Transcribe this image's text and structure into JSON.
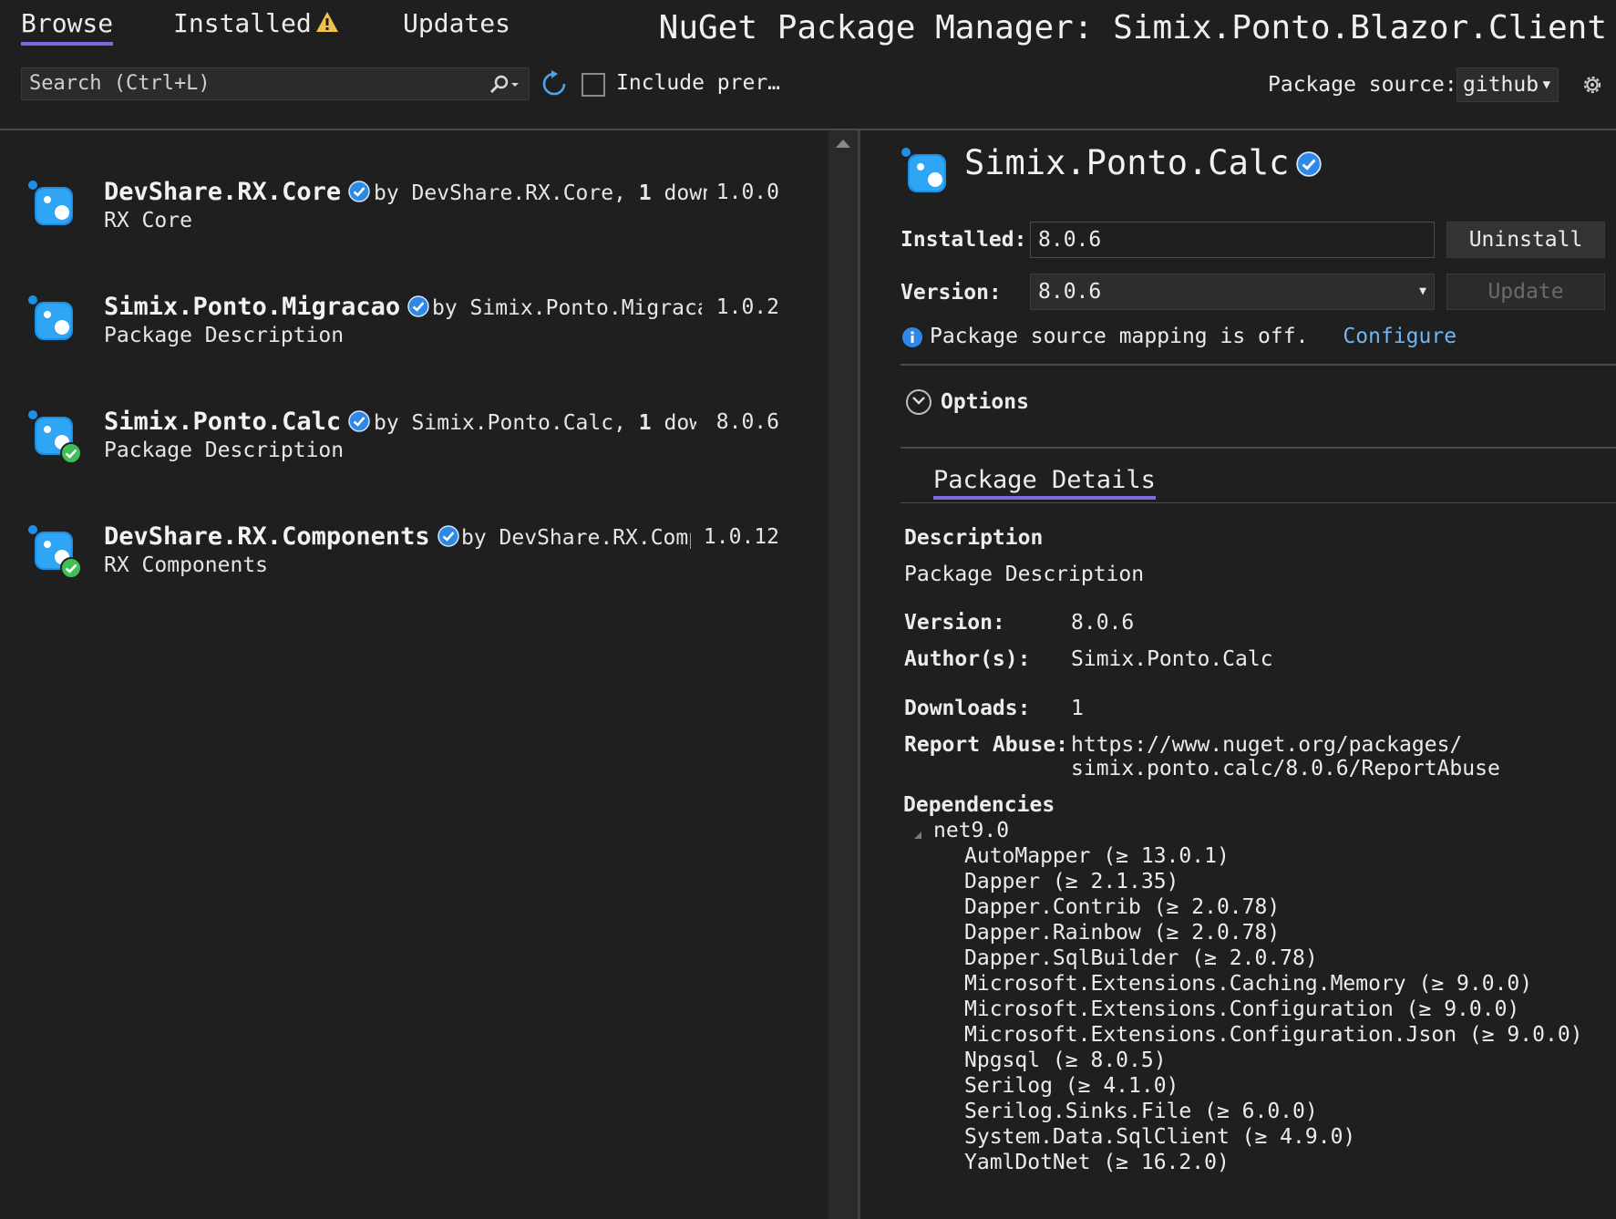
{
  "tabs": [
    {
      "label": "Browse",
      "active": true
    },
    {
      "label": "Installed",
      "warning": true
    },
    {
      "label": "Updates"
    }
  ],
  "window_title": "NuGet Package Manager: Simix.Ponto.Blazor.Client",
  "search": {
    "placeholder": "Search (Ctrl+L)"
  },
  "include_prerelease": {
    "label": "Include prer…",
    "checked": false
  },
  "package_source": {
    "label": "Package source:",
    "value": "github"
  },
  "packages": [
    {
      "name": "DevShare.RX.Core",
      "meta_by": "by DevShare.RX.Core, ",
      "meta_count": "1",
      "meta_tail": " downl",
      "version": "1.0.0",
      "description": "RX Core",
      "installed": false
    },
    {
      "name": "Simix.Ponto.Migracao",
      "meta_by": "by Simix.Ponto.Migracao",
      "meta_count": "",
      "meta_tail": "",
      "version": "1.0.2",
      "description": "Package Description",
      "installed": false
    },
    {
      "name": "Simix.Ponto.Calc",
      "meta_by": "by Simix.Ponto.Calc, ",
      "meta_count": "1",
      "meta_tail": " downl",
      "version": "8.0.6",
      "description": "Package Description",
      "installed": true
    },
    {
      "name": "DevShare.RX.Components",
      "meta_by": "by DevShare.RX.Comp",
      "meta_count": "",
      "meta_tail": "",
      "version": "1.0.12",
      "description": "RX Components",
      "installed": true
    }
  ],
  "detail": {
    "title": "Simix.Ponto.Calc",
    "installed_label": "Installed:",
    "installed_value": "8.0.6",
    "uninstall_label": "Uninstall",
    "version_label": "Version:",
    "version_value": "8.0.6",
    "update_label": "Update",
    "mapping_text": "Package source mapping is off.",
    "configure_label": "Configure",
    "options_label": "Options",
    "details_tab": "Package Details",
    "description_heading": "Description",
    "description_text": "Package Description",
    "fields": {
      "version_label": "Version:",
      "version_value": "8.0.6",
      "authors_label": "Author(s):",
      "authors_value": "Simix.Ponto.Calc",
      "downloads_label": "Downloads:",
      "downloads_value": "1",
      "report_label": "Report Abuse:",
      "report_line1": "https://www.nuget.org/packages/",
      "report_line2": "simix.ponto.calc/8.0.6/ReportAbuse"
    },
    "dependencies_heading": "Dependencies",
    "framework": "net9.0",
    "dependencies": [
      "AutoMapper (≥ 13.0.1)",
      "Dapper (≥ 2.1.35)",
      "Dapper.Contrib (≥ 2.0.78)",
      "Dapper.Rainbow (≥ 2.0.78)",
      "Dapper.SqlBuilder (≥ 2.0.78)",
      "Microsoft.Extensions.Caching.Memory (≥ 9.0.0)",
      "Microsoft.Extensions.Configuration (≥ 9.0.0)",
      "Microsoft.Extensions.Configuration.Json (≥ 9.0.0)",
      "Npgsql (≥ 8.0.5)",
      "Serilog (≥ 4.1.0)",
      "Serilog.Sinks.File (≥ 6.0.0)",
      "System.Data.SqlClient (≥ 4.9.0)",
      "YamlDotNet (≥ 16.2.0)"
    ]
  },
  "colors": {
    "accent": "#7b6ce6",
    "link": "#6fb6f7",
    "background": "#1f1f1f",
    "verified": "#2f88e6",
    "installed": "#3fbf55"
  }
}
